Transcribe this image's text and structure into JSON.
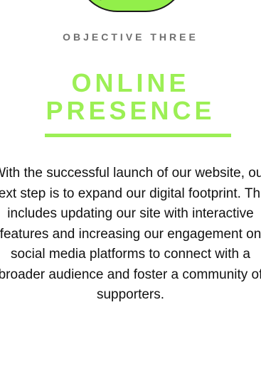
{
  "section": {
    "eyebrow": "OBJECTIVE THREE",
    "title_line1": "ONLINE",
    "title_line2": "PRESENCE",
    "body": "With the successful launch of our website, our next step is to expand our digital footprint. This includes updating our site with interactive features and increasing our engagement on social media platforms to connect with a broader audience and foster a community of supporters."
  },
  "colors": {
    "accent": "#9cef55",
    "eyebrow": "#6f6f6f",
    "text": "#111111"
  }
}
